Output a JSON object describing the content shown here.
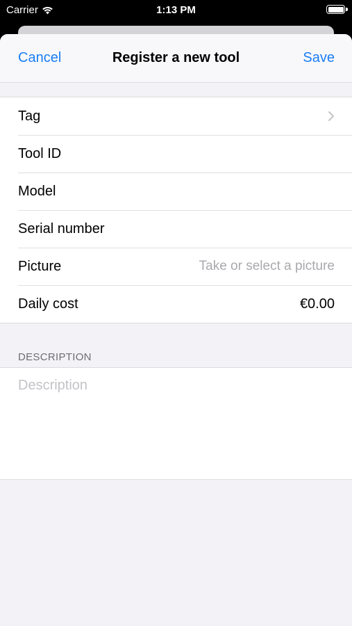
{
  "status_bar": {
    "carrier": "Carrier",
    "time": "1:13 PM",
    "wifi_icon": "wifi-icon",
    "battery_icon": "battery-icon"
  },
  "nav": {
    "cancel_label": "Cancel",
    "title": "Register a new tool",
    "save_label": "Save"
  },
  "form": {
    "rows": [
      {
        "label": "Tag",
        "accessory": "chevron-right-icon"
      },
      {
        "label": "Tool ID"
      },
      {
        "label": "Model"
      },
      {
        "label": "Serial number"
      },
      {
        "label": "Picture",
        "placeholder": "Take or select a picture"
      },
      {
        "label": "Daily cost",
        "value": "€0.00"
      }
    ]
  },
  "description": {
    "header": "DESCRIPTION",
    "placeholder": "Description"
  },
  "colors": {
    "accent": "#1a7df5",
    "background": "#f2f2f7",
    "placeholder": "#a9a9ae"
  }
}
